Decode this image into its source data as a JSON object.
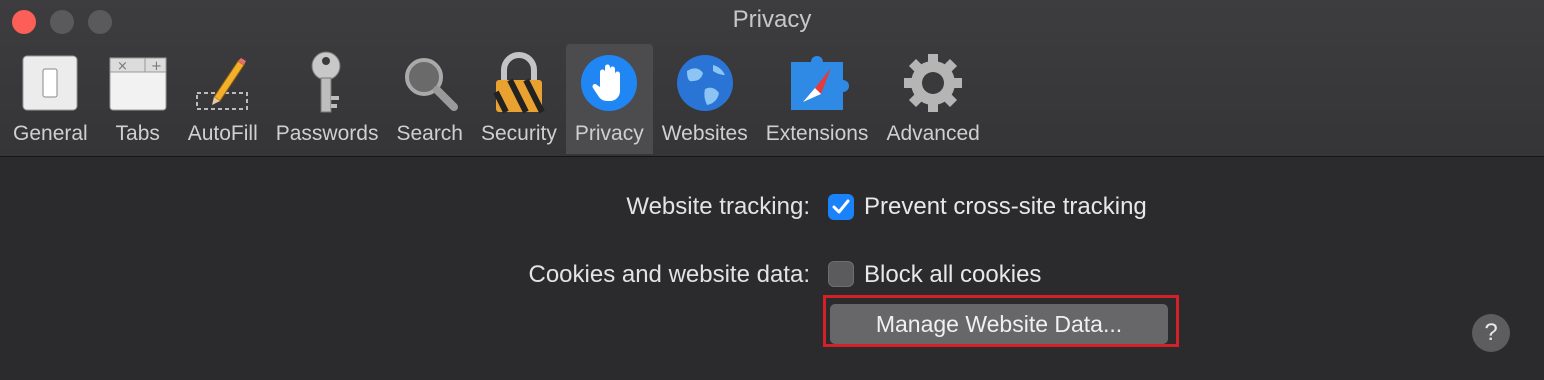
{
  "window": {
    "title": "Privacy"
  },
  "toolbar": {
    "items": [
      {
        "label": "General",
        "icon": "switch-icon"
      },
      {
        "label": "Tabs",
        "icon": "tabs-icon"
      },
      {
        "label": "AutoFill",
        "icon": "pencil-icon"
      },
      {
        "label": "Passwords",
        "icon": "key-icon"
      },
      {
        "label": "Search",
        "icon": "magnifier-icon"
      },
      {
        "label": "Security",
        "icon": "lock-icon"
      },
      {
        "label": "Privacy",
        "icon": "hand-icon",
        "selected": true
      },
      {
        "label": "Websites",
        "icon": "globe-icon"
      },
      {
        "label": "Extensions",
        "icon": "compass-puzzle-icon"
      },
      {
        "label": "Advanced",
        "icon": "gear-icon"
      }
    ]
  },
  "privacy": {
    "tracking": {
      "label": "Website tracking:",
      "option": "Prevent cross-site tracking",
      "checked": true
    },
    "cookies": {
      "label": "Cookies and website data:",
      "option": "Block all cookies",
      "checked": false
    },
    "manage_button": "Manage Website Data...",
    "help": "?"
  },
  "colors": {
    "accent": "#1a82fb",
    "highlight_box": "#d42027",
    "close_light": "#fc5f57"
  }
}
